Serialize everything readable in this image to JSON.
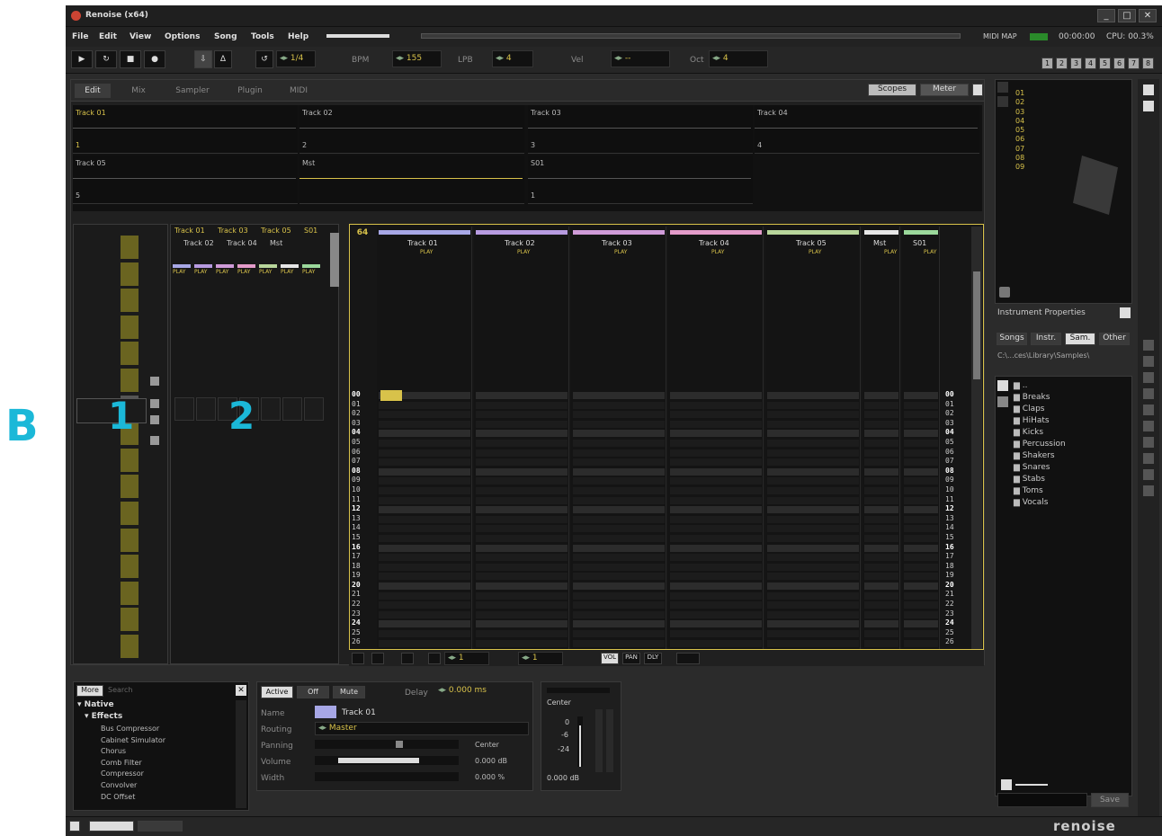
{
  "annotations": {
    "b": "B",
    "one": "1",
    "two": "2"
  },
  "window": {
    "title": "Renoise (x64)",
    "min": "_",
    "max": "□",
    "close": "✕"
  },
  "menu": [
    "File",
    "Edit",
    "View",
    "Options",
    "Song",
    "Tools",
    "Help"
  ],
  "status": {
    "midi_map": "MIDI MAP",
    "time": "00:00:00",
    "cpu": "CPU: 00.3%"
  },
  "transport": {
    "lines": "1/4",
    "bpm_label": "BPM",
    "bpm": "155",
    "lpb_label": "LPB",
    "lpb": "4",
    "vel_label": "Vel",
    "vel": "--",
    "oct_label": "Oct",
    "oct": "4"
  },
  "tracks_num": [
    "1",
    "2",
    "3",
    "4",
    "5",
    "6",
    "7",
    "8"
  ],
  "tabs": [
    "Edit",
    "Mix",
    "Sampler",
    "Plugin",
    "MIDI"
  ],
  "scope_btns": [
    "Scopes",
    "Meter"
  ],
  "slots": [
    {
      "name": "Track 01",
      "num": "1"
    },
    {
      "name": "Track 02",
      "num": "2"
    },
    {
      "name": "Track 03",
      "num": "3"
    },
    {
      "name": "Track 04",
      "num": "4"
    },
    {
      "name": "Track 05",
      "num": "5"
    },
    {
      "name": "Mst",
      "num": ""
    },
    {
      "name": "S01",
      "num": "1"
    }
  ],
  "matrix": {
    "top": [
      "Track 01",
      "Track 03",
      "Track 05",
      "S01"
    ],
    "bottom": [
      "Track 02",
      "Track 04",
      "Mst"
    ],
    "play": "PLAY"
  },
  "pattern": {
    "count": "64",
    "rows": [
      "00",
      "01",
      "02",
      "03",
      "04",
      "05",
      "06",
      "07",
      "08",
      "09",
      "10",
      "11",
      "12",
      "13",
      "14",
      "15",
      "16",
      "17",
      "18",
      "19",
      "20",
      "21",
      "22",
      "23",
      "24",
      "25",
      "26"
    ]
  },
  "pattern_tracks": [
    {
      "name": "Track 01",
      "color": "#a7a7e6"
    },
    {
      "name": "Track 02",
      "color": "#b79be0"
    },
    {
      "name": "Track 03",
      "color": "#cf9bd8"
    },
    {
      "name": "Track 04",
      "color": "#e39bc9"
    },
    {
      "name": "Track 05",
      "color": "#b8d69b"
    },
    {
      "name": "Mst",
      "color": "#e6e6e6"
    },
    {
      "name": "S01",
      "color": "#9bd89b"
    }
  ],
  "pattern_bar": {
    "step": "1",
    "edit_step": "1",
    "vol": "VOL",
    "pan": "PAN",
    "dly": "DLY"
  },
  "instruments": {
    "items": [
      "01",
      "02",
      "03",
      "04",
      "05",
      "06",
      "07",
      "08",
      "09"
    ],
    "properties": "Instrument Properties"
  },
  "browser": {
    "tabs": [
      "Songs",
      "Instr.",
      "Sam.",
      "Other"
    ],
    "path": "C:\\...ces\\Library\\Samples\\",
    "up": "..",
    "folders": [
      "Breaks",
      "Claps",
      "HiHats",
      "Kicks",
      "Percussion",
      "Shakers",
      "Snares",
      "Stabs",
      "Toms",
      "Vocals"
    ],
    "save": "Save"
  },
  "dsp": {
    "more": "More",
    "search": "Search",
    "native": "Native",
    "effects": "Effects",
    "list": [
      "Bus Compressor",
      "Cabinet Simulator",
      "Chorus",
      "Comb Filter",
      "Compressor",
      "Convolver",
      "DC Offset"
    ]
  },
  "track_props": {
    "active": "Active",
    "off": "Off",
    "mute": "Mute",
    "delay_label": "Delay",
    "delay": "0.000 ms",
    "name_label": "Name",
    "name": "Track 01",
    "routing_label": "Routing",
    "routing": "Master",
    "panning_label": "Panning",
    "panning": "Center",
    "volume_label": "Volume",
    "volume": "0.000 dB",
    "width_label": "Width",
    "width": "0.000 %"
  },
  "master": {
    "pan": "Center",
    "db": "0.000 dB",
    "scale": [
      "0",
      "-6",
      "-24"
    ]
  },
  "logo": "renoise",
  "colors": {
    "accent": "#d8c24a",
    "bg": "#2b2b2b",
    "cyan": "#1bb8d8"
  }
}
